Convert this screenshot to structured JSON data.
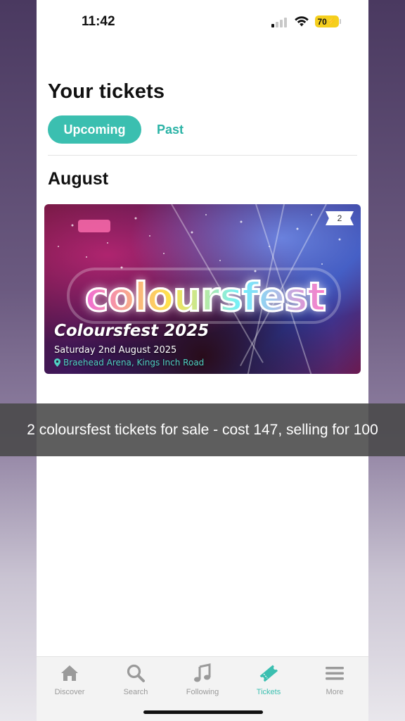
{
  "status_bar": {
    "time": "11:42",
    "battery": "70"
  },
  "page": {
    "title": "Your tickets"
  },
  "tabs": [
    {
      "label": "Upcoming",
      "active": true
    },
    {
      "label": "Past",
      "active": false
    }
  ],
  "month_heading": "August",
  "event": {
    "logo_text": "coloursfest",
    "title": "Coloursfest 2025",
    "date": "Saturday 2nd August 2025",
    "venue": "Braehead Arena, Kings Inch Road",
    "ticket_count": "2"
  },
  "caption": "2 coloursfest tickets for sale - cost 147, selling for 100",
  "bottom_nav": [
    {
      "label": "Discover",
      "icon": "home-icon"
    },
    {
      "label": "Search",
      "icon": "search-icon"
    },
    {
      "label": "Following",
      "icon": "music-note-icon"
    },
    {
      "label": "Tickets",
      "icon": "ticket-icon",
      "active": true
    },
    {
      "label": "More",
      "icon": "menu-icon"
    }
  ],
  "colors": {
    "accent": "#3bbfb0",
    "battery": "#f5cf1d"
  }
}
